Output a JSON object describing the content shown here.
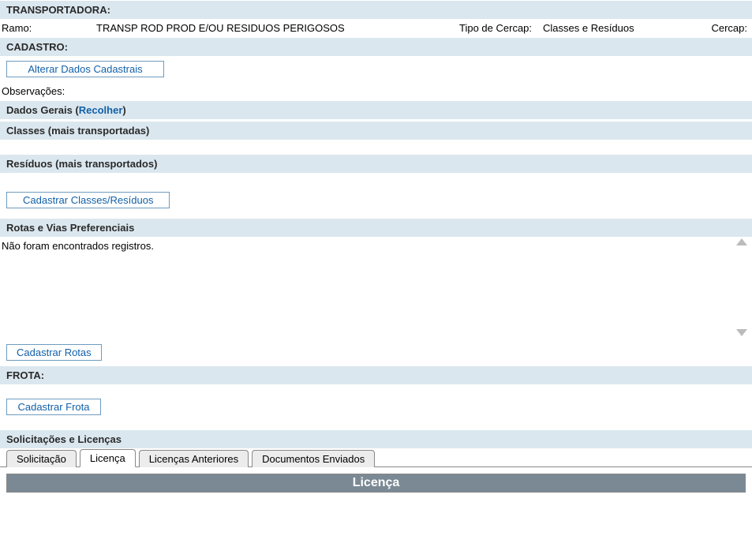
{
  "transportadora": {
    "header": "TRANSPORTADORA:"
  },
  "ramo": {
    "label": "Ramo:",
    "value": "TRANSP ROD PROD E/OU RESIDUOS PERIGOSOS",
    "tipoCercapLabel": "Tipo de Cercap:",
    "tipoCercapValue": "Classes e Resíduos",
    "cercapLabel": "Cercap:"
  },
  "cadastro": {
    "header": "CADASTRO:",
    "alterarBtn": "Alterar Dados Cadastrais",
    "observacoesLabel": "Observações:"
  },
  "dadosGerais": {
    "prefix": "Dados Gerais (",
    "toggle": "Recolher",
    "suffix": ")"
  },
  "classes": {
    "header": "Classes (mais transportadas)"
  },
  "residuos": {
    "header": "Resíduos (mais transportados)",
    "cadastrarBtn": "Cadastrar Classes/Resíduos"
  },
  "rotas": {
    "header": "Rotas e Vias Preferenciais",
    "empty": "Não foram encontrados registros.",
    "cadastrarBtn": "Cadastrar Rotas"
  },
  "frota": {
    "header": "FROTA:",
    "cadastrarBtn": "Cadastrar Frota"
  },
  "solicitacoes": {
    "header": "Solicitações e Licenças",
    "tabs": {
      "solicitacao": "Solicitação",
      "licenca": "Licença",
      "anteriores": "Licenças Anteriores",
      "documentos": "Documentos Enviados"
    },
    "panelTitle": "Licença"
  }
}
